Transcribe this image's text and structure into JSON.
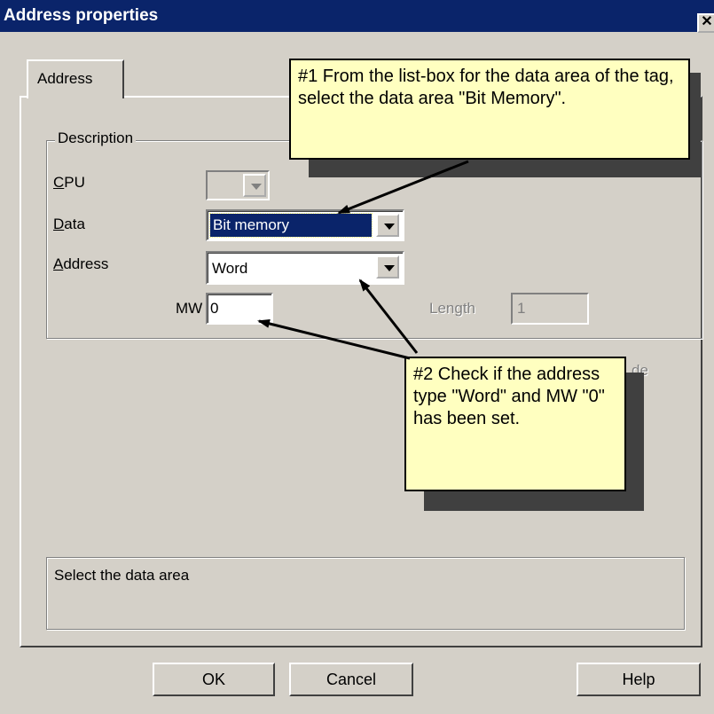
{
  "window": {
    "title": "Address properties",
    "close_glyph": "✕"
  },
  "tabs": [
    {
      "label": "Address"
    }
  ],
  "description": {
    "group_label": "Description",
    "cpu": {
      "label_first": "C",
      "label_rest": "PU",
      "value": ""
    },
    "data": {
      "label_first": "D",
      "label_rest": "ata",
      "value": "Bit memory"
    },
    "address": {
      "label_first": "A",
      "label_rest": "ddress",
      "value": "Word"
    },
    "mw": {
      "label": "MW",
      "value": "0"
    },
    "length": {
      "label": "Length",
      "value": "1"
    }
  },
  "obscured_text": "de",
  "status_text": "Select the data area",
  "buttons": {
    "ok": "OK",
    "cancel": "Cancel",
    "help": "Help"
  },
  "callouts": {
    "one": "#1 From the list-box for the data area of the tag, select the data area \"Bit Memory\".",
    "two": "#2 Check if the address type \"Word\" and MW \"0\" has been set."
  },
  "colors": {
    "titlebar": "#0a246a",
    "dialog": "#d4d0c8",
    "callout": "#ffffc0",
    "selection": "#0a246a"
  }
}
